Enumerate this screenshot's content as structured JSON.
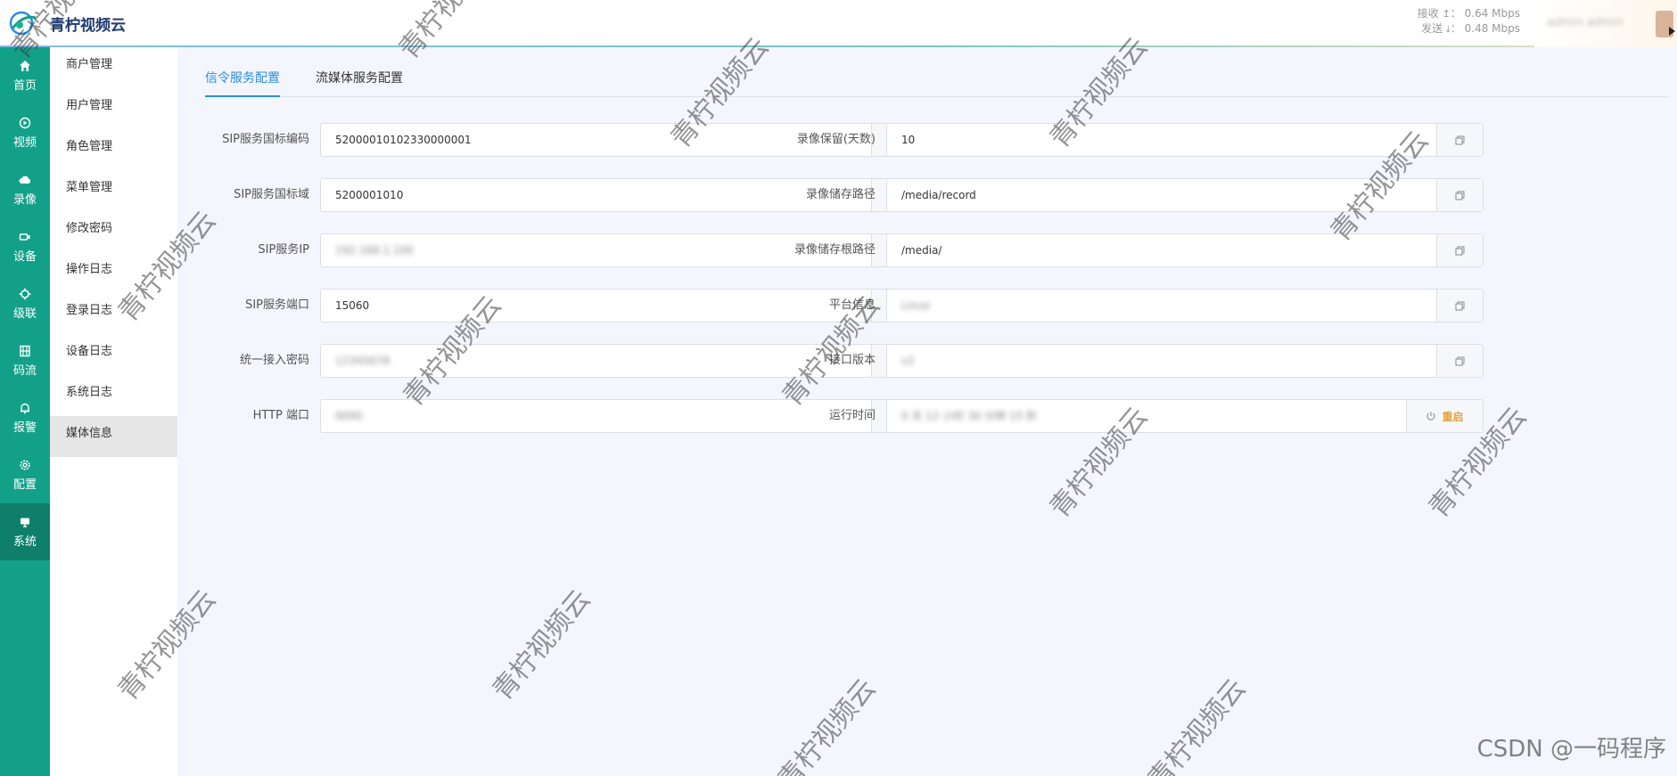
{
  "header": {
    "brand": "青柠视频云",
    "net": {
      "recv_label": "接收",
      "recv_value": "0.64 Mbps",
      "send_label": "发送",
      "send_value": "0.48 Mbps"
    },
    "user_name": "admin admin"
  },
  "rail": [
    {
      "label": "首页",
      "icon": "home-icon"
    },
    {
      "label": "视频",
      "icon": "play-icon"
    },
    {
      "label": "录像",
      "icon": "cloud-icon"
    },
    {
      "label": "设备",
      "icon": "camera-icon"
    },
    {
      "label": "级联",
      "icon": "chip-icon"
    },
    {
      "label": "码流",
      "icon": "film-icon"
    },
    {
      "label": "报警",
      "icon": "bell-icon"
    },
    {
      "label": "配置",
      "icon": "gear-icon"
    },
    {
      "label": "系统",
      "icon": "monitor-icon",
      "active": true
    }
  ],
  "submenu": [
    "商户管理",
    "用户管理",
    "角色管理",
    "菜单管理",
    "修改密码",
    "操作日志",
    "登录日志",
    "设备日志",
    "系统日志",
    "媒体信息"
  ],
  "tabs": [
    "信令服务配置",
    "流媒体服务配置"
  ],
  "left_fields": [
    {
      "label": "SIP服务国标编码",
      "value": "52000010102330000001"
    },
    {
      "label": "SIP服务国标域",
      "value": "5200001010"
    },
    {
      "label": "SIP服务IP",
      "value": "192.168.1.100"
    },
    {
      "label": "SIP服务端口",
      "value": "15060"
    },
    {
      "label": "统一接入密码",
      "value": "12345678"
    },
    {
      "label": "HTTP 端口",
      "value": "9090"
    }
  ],
  "right_fields": [
    {
      "label": "录像保留(天数)",
      "value": "10"
    },
    {
      "label": "录像储存路径",
      "value": "/media/record"
    },
    {
      "label": "录像储存根路径",
      "value": "/media/"
    },
    {
      "label": "平台信息",
      "value": "Linux"
    },
    {
      "label": "接口版本",
      "value": "v2"
    },
    {
      "label": "运行时间",
      "value": "0 天 12 小时 30 分钟 15 秒"
    }
  ],
  "restart_label": "重启",
  "watermark_text": "青柠视频云",
  "csdn_mark": "CSDN @一码程序",
  "colors": {
    "rail": "#13a089",
    "accent": "#2b8de3",
    "warning": "#e6a23c"
  }
}
